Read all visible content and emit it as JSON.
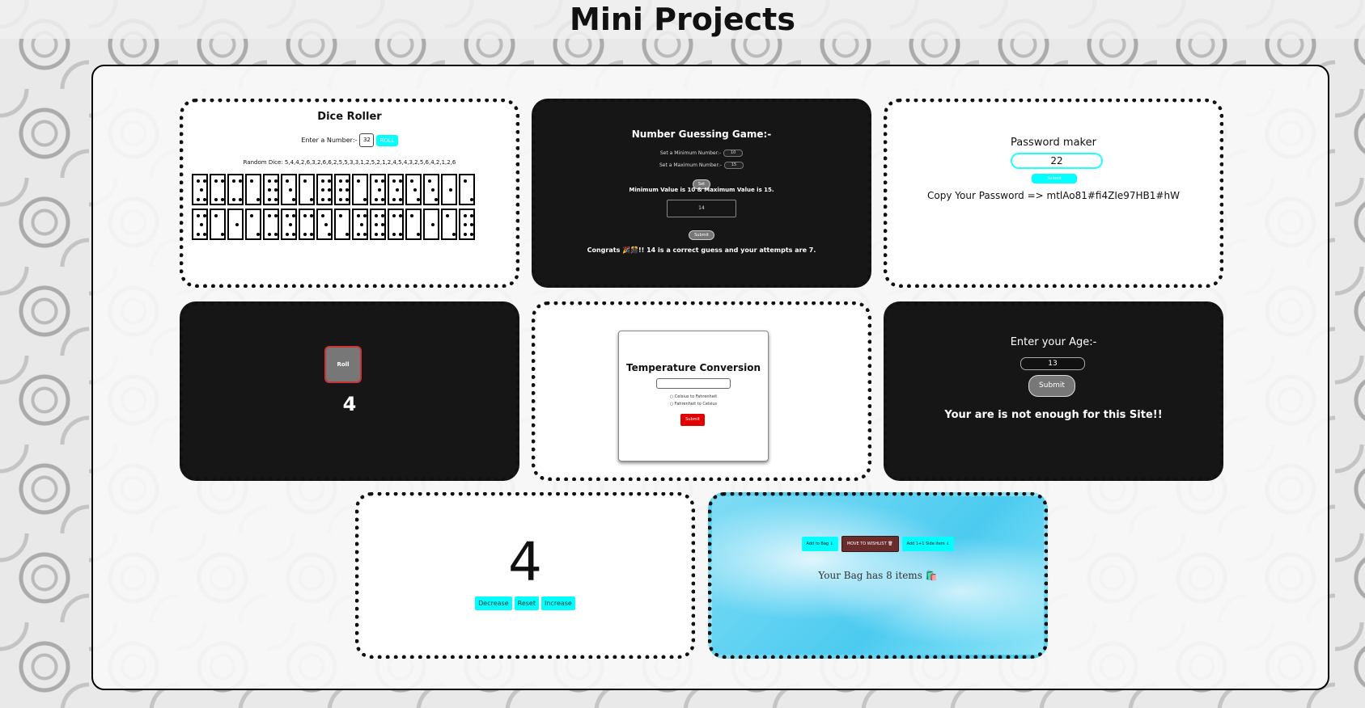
{
  "header": {
    "title": "Mini Projects"
  },
  "dice_roller": {
    "title": "Dice Roller",
    "input_label": "Enter a Number:-",
    "input_value": "32",
    "roll_label": "ROLL",
    "random_dice_text": "Random Dice: 5,4,4,2,6,3,2,6,6,2,5,5,3,3,1,2,5,2,1,2,4,5,4,3,2,5,6,4,2,1,2,6",
    "dice_values": [
      5,
      4,
      4,
      2,
      6,
      3,
      2,
      6,
      6,
      2,
      5,
      5,
      3,
      3,
      1,
      2,
      5,
      2,
      1,
      2,
      4,
      5,
      4,
      3,
      2,
      5,
      6,
      4,
      2,
      1,
      2,
      6
    ]
  },
  "number_guess": {
    "title": "Number Guessing Game:-",
    "min_label": "Set a Minimum Number:-",
    "min_value": "10",
    "max_label": "Set a Maximum Number:-",
    "max_value": "15",
    "set_label": "Set",
    "range_text": "Minimum Value is 10 & Maximum Value is 15.",
    "guess_value": "14",
    "submit_label": "Submit",
    "congrats_text": "Congrats 🎉🎊!! 14 is a correct guess and your attempts are 7."
  },
  "password_maker": {
    "title": "Password maker",
    "length_value": "22",
    "submit_label": "Submit",
    "copy_text": "Copy Your Password => mtlAo81#fi4ZIe97HB1#hW"
  },
  "roll_game": {
    "button_label": "Roll",
    "value": "4"
  },
  "temperature": {
    "title": "Temperature Conversion",
    "input_value": "",
    "option_c_to_f": "Celsius to Fahrenheit",
    "option_f_to_c": "Fahrenheit to Celsius",
    "submit_label": "Submit"
  },
  "age_checker": {
    "title": "Enter your Age:-",
    "age_value": "13",
    "submit_label": "Submit",
    "message": "Your are is not enough for this Site!!"
  },
  "counter": {
    "value": "4",
    "decrease_label": "Decrease",
    "reset_label": "Reset",
    "increase_label": "Increase"
  },
  "bag": {
    "add_bag_label": "Add to Bag ⇓",
    "wishlist_label": "MOVE TO WISHLIST 🗑",
    "add_side_label": "Add 1+1 Side item ⇓",
    "bag_text": "Your Bag has 8 items 🛍️"
  }
}
